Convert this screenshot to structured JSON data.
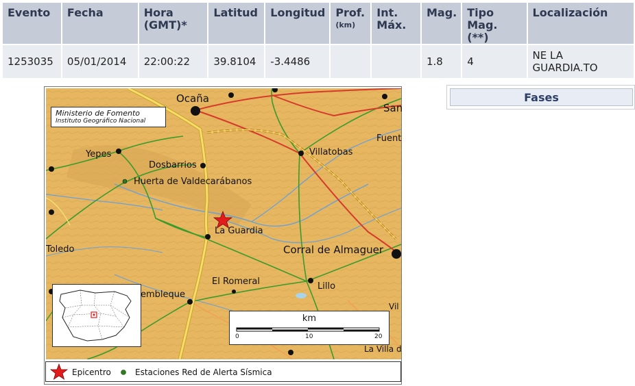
{
  "table": {
    "headers": [
      {
        "label": "Evento",
        "sub": ""
      },
      {
        "label": "Fecha",
        "sub": ""
      },
      {
        "label": "Hora",
        "sub": "(GMT)*"
      },
      {
        "label": "Latitud",
        "sub": ""
      },
      {
        "label": "Longitud",
        "sub": ""
      },
      {
        "label": "Prof.",
        "sub": "(km)"
      },
      {
        "label": "Int.",
        "sub": "Máx."
      },
      {
        "label": "Mag.",
        "sub": ""
      },
      {
        "label": "Tipo",
        "sub": "Mag. (**)"
      },
      {
        "label": "Localización",
        "sub": ""
      }
    ],
    "row": {
      "evento": "1253035",
      "fecha": "05/01/2014",
      "hora": "22:00:22",
      "latitud": "39.8104",
      "longitud": "-3.4486",
      "prof": "",
      "int_max": "",
      "mag": "1.8",
      "tipo_mag": "4",
      "localizacion_1": "NE LA",
      "localizacion_2": "GUARDIA.TO"
    }
  },
  "map": {
    "credit_line1": "Ministerio de Fomento",
    "credit_line2": "Instituto Geográfico Nacional",
    "places": {
      "ocana": "Ocaña",
      "yepes": "Yepes",
      "dosbarrios": "Dosbarrios",
      "huerta": "Huerta de Valdecarábanos",
      "villatobas": "Villatobas",
      "fuente": "Fuent",
      "san": "San",
      "la_guardia": "La Guardia",
      "corral": "Corral de Almaguer",
      "toledo": "Toledo",
      "el_romeral": "El Romeral",
      "lillo": "Lillo",
      "tembleque": "embleque",
      "la_villa": "La Villa d",
      "vil": "Vil"
    },
    "scale": {
      "unit": "km",
      "ticks": [
        "0",
        "10",
        "20"
      ]
    },
    "legend": {
      "epicentro": "Epicentro",
      "estaciones": "Estaciones Red de Alerta Sísmica"
    },
    "colors": {
      "terrain": "#e6b660",
      "epicentre": "#e21c1c",
      "station": "#2e7d1f",
      "highway": "#d63a2a",
      "river": "#6ba0d8",
      "road": "#3a9a2c"
    }
  },
  "fases_button": "Fases"
}
